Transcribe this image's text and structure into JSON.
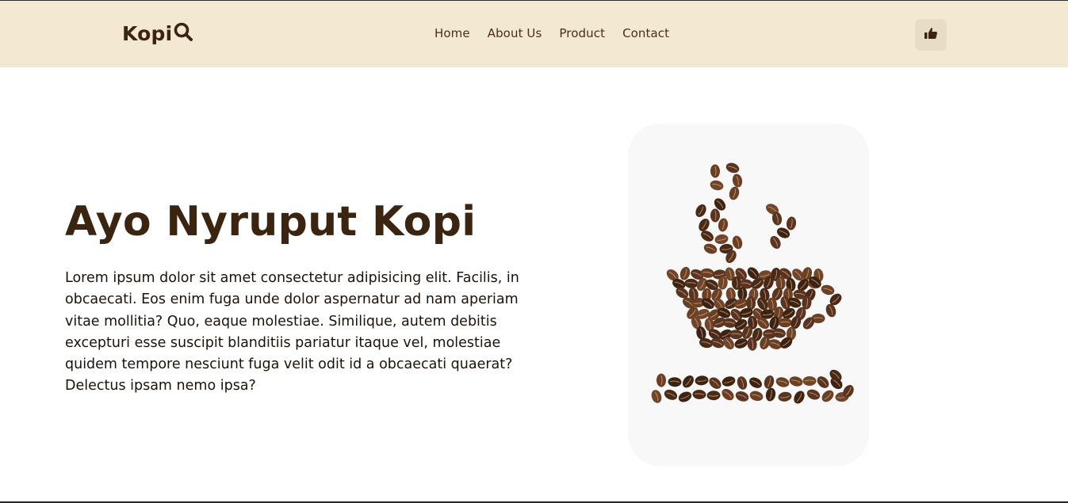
{
  "brand": {
    "name": "Kopi",
    "icon": "magnifier-icon"
  },
  "nav": {
    "items": [
      {
        "label": "Home"
      },
      {
        "label": "About Us"
      },
      {
        "label": "Product"
      },
      {
        "label": "Contact"
      }
    ]
  },
  "actions": {
    "like_icon": "thumbs-up-icon"
  },
  "hero": {
    "title": "Ayo Nyruput Kopi",
    "description": "Lorem ipsum dolor sit amet consectetur adipisicing elit. Facilis, in obcaecati. Eos enim fuga unde dolor aspernatur ad nam aperiam vitae mollitia? Quo, eaque molestiae. Similique, autem debitis excepturi esse suscipit blanditiis pariatur itaque vel, molestiae quidem tempore nesciunt fuga velit odit id a obcaecati quaerat? Delectus ipsam nemo ipsa?",
    "image": "coffee-bean-cup-image"
  },
  "colors": {
    "header_bg": "#f3e9d2",
    "brand_brown": "#3b2410",
    "button_bg": "#e7dcc4",
    "bean": "#5a3420"
  }
}
